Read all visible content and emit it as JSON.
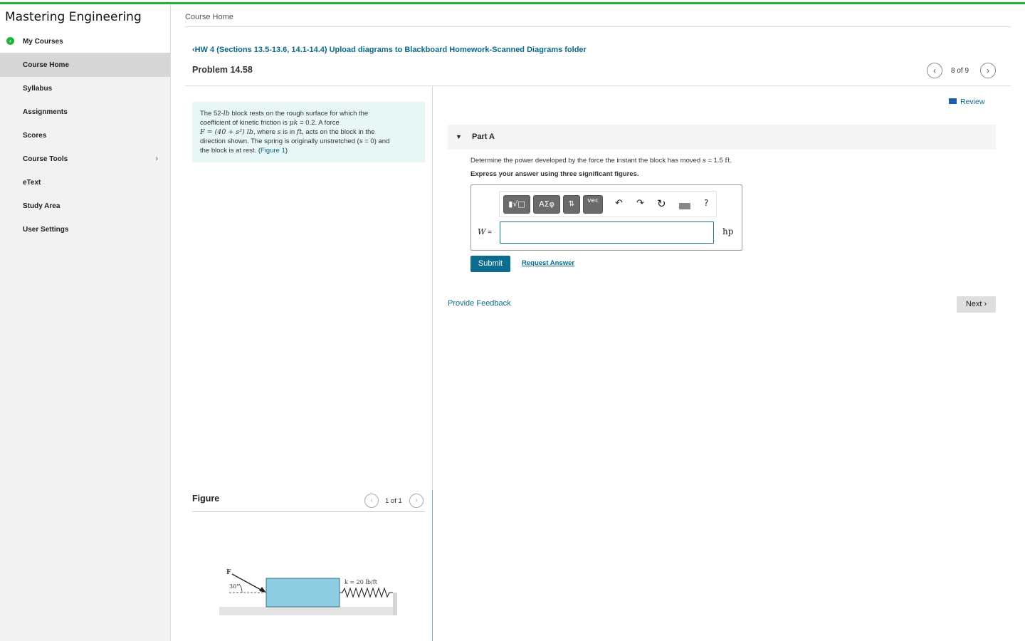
{
  "app": {
    "brand": "Mastering Engineering"
  },
  "sidebar": {
    "items": [
      {
        "label": "My Courses"
      },
      {
        "label": "Course Home"
      },
      {
        "label": "Syllabus"
      },
      {
        "label": "Assignments"
      },
      {
        "label": "Scores"
      },
      {
        "label": "Course Tools"
      },
      {
        "label": "eText"
      },
      {
        "label": "Study Area"
      },
      {
        "label": "User Settings"
      }
    ]
  },
  "header": {
    "breadcrumb": "Course Home",
    "assignment_link": "‹HW 4 (Sections 13.5-13.6, 14.1-14.4) Upload diagrams to Blackboard Homework-Scanned Diagrams folder",
    "problem_title": "Problem 14.58",
    "pager": {
      "text": "8 of 9"
    }
  },
  "problem": {
    "statement": {
      "line1": "The 52-",
      "line1_unit": "lb",
      "line1_b": " block rests on the rough surface for which the",
      "line2": "coefficient of kinetic friction is ",
      "line2_math": "μk",
      "line2_b": " = 0.2. A force",
      "line3_math": "F = (40 + s²) lb",
      "line3_b": ", where ",
      "line3_s": "s",
      "line3_c": " is in ",
      "line3_ft": "ft",
      "line3_d": ", acts on the block in the",
      "line4": "direction shown. The spring is originally unstretched (",
      "line4_math": "s",
      "line4_b": " = 0) and",
      "line5": "the block is at rest. (",
      "line5_link": "Figure 1",
      "line5_b": ")"
    },
    "figure": {
      "title": "Figure",
      "pager": "1 of 1",
      "force_label": "F",
      "angle_label": "30°",
      "spring_label": "k = 20 lb/ft"
    }
  },
  "part": {
    "review": "Review",
    "label": "Part A",
    "question_a": "Determine the power developed by the force the instant the block has moved ",
    "question_math": "s",
    "question_b": " = 1.5 ",
    "question_ft": "ft",
    "question_c": ".",
    "instruction": "Express your answer using three significant figures.",
    "toolbar": {
      "templates": "▮√□",
      "symbols": "ΑΣφ",
      "arrows": "⇅",
      "vec": "vec",
      "undo": "↶",
      "redo": "↷",
      "reset": "↻",
      "help": "?"
    },
    "variable": "W",
    "equals": " =",
    "input_value": "",
    "unit": "hp",
    "submit": "Submit",
    "request_answer": "Request Answer"
  },
  "footer": {
    "feedback": "Provide Feedback",
    "next": "Next ›"
  },
  "colors": {
    "accent": "#0a6a8a",
    "brand_green": "#1fb33a",
    "submit": "#0d6d8f"
  }
}
